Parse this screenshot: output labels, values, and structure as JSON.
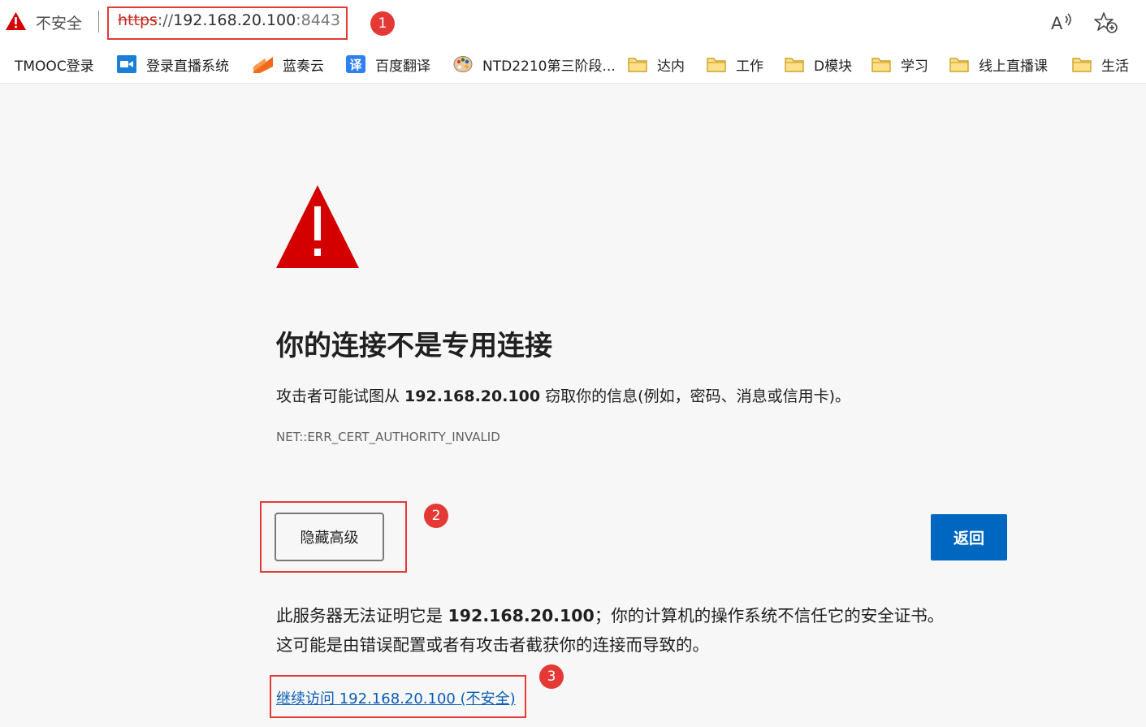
{
  "address_bar": {
    "security_status": "不安全",
    "url_scheme": "https",
    "url_separator": "://",
    "url_host": "192.168.20.100",
    "url_port": ":8443",
    "icons": [
      "warning-triangle-icon",
      "read-aloud-icon",
      "add-favorite-icon"
    ]
  },
  "bookmarks": [
    {
      "label": "TMOOC登录",
      "icon": "none"
    },
    {
      "label": "登录直播系统",
      "icon": "video-camera-icon"
    },
    {
      "label": "蓝奏云",
      "icon": "lanzou-icon"
    },
    {
      "label": "百度翻译",
      "icon": "translate-icon"
    },
    {
      "label": "NTD2210第三阶段...",
      "icon": "palette-icon"
    },
    {
      "label": "达内",
      "icon": "folder-icon"
    },
    {
      "label": "工作",
      "icon": "folder-icon"
    },
    {
      "label": "D模块",
      "icon": "folder-icon"
    },
    {
      "label": "学习",
      "icon": "folder-icon"
    },
    {
      "label": "线上直播课",
      "icon": "folder-icon"
    },
    {
      "label": "生活",
      "icon": "folder-icon"
    }
  ],
  "page": {
    "heading": "你的连接不是专用连接",
    "desc_before": "攻击者可能试图从 ",
    "desc_host": "192.168.20.100",
    "desc_after": " 窃取你的信息(例如，密码、消息或信用卡)。",
    "error_code": "NET::ERR_CERT_AUTHORITY_INVALID",
    "advanced_button": "隐藏高级",
    "back_button": "返回",
    "detail_line1_before": "此服务器无法证明它是 ",
    "detail_line1_host": "192.168.20.100",
    "detail_line1_after": "；你的计算机的操作系统不信任它的安全证书。",
    "detail_line2": "这可能是由错误配置或者有攻击者截获你的连接而导致的。",
    "proceed_link": "继续访问 192.168.20.100 (不安全)"
  },
  "annotations": {
    "marker_1": "1",
    "marker_2": "2",
    "marker_3": "3",
    "color": "#e53935"
  },
  "colors": {
    "warning_red": "#d40000",
    "back_button_blue": "#0067c0",
    "link_blue": "#0a5db5",
    "insecure_scheme_red": "#c42b1c",
    "page_background": "#f7f7f7"
  }
}
